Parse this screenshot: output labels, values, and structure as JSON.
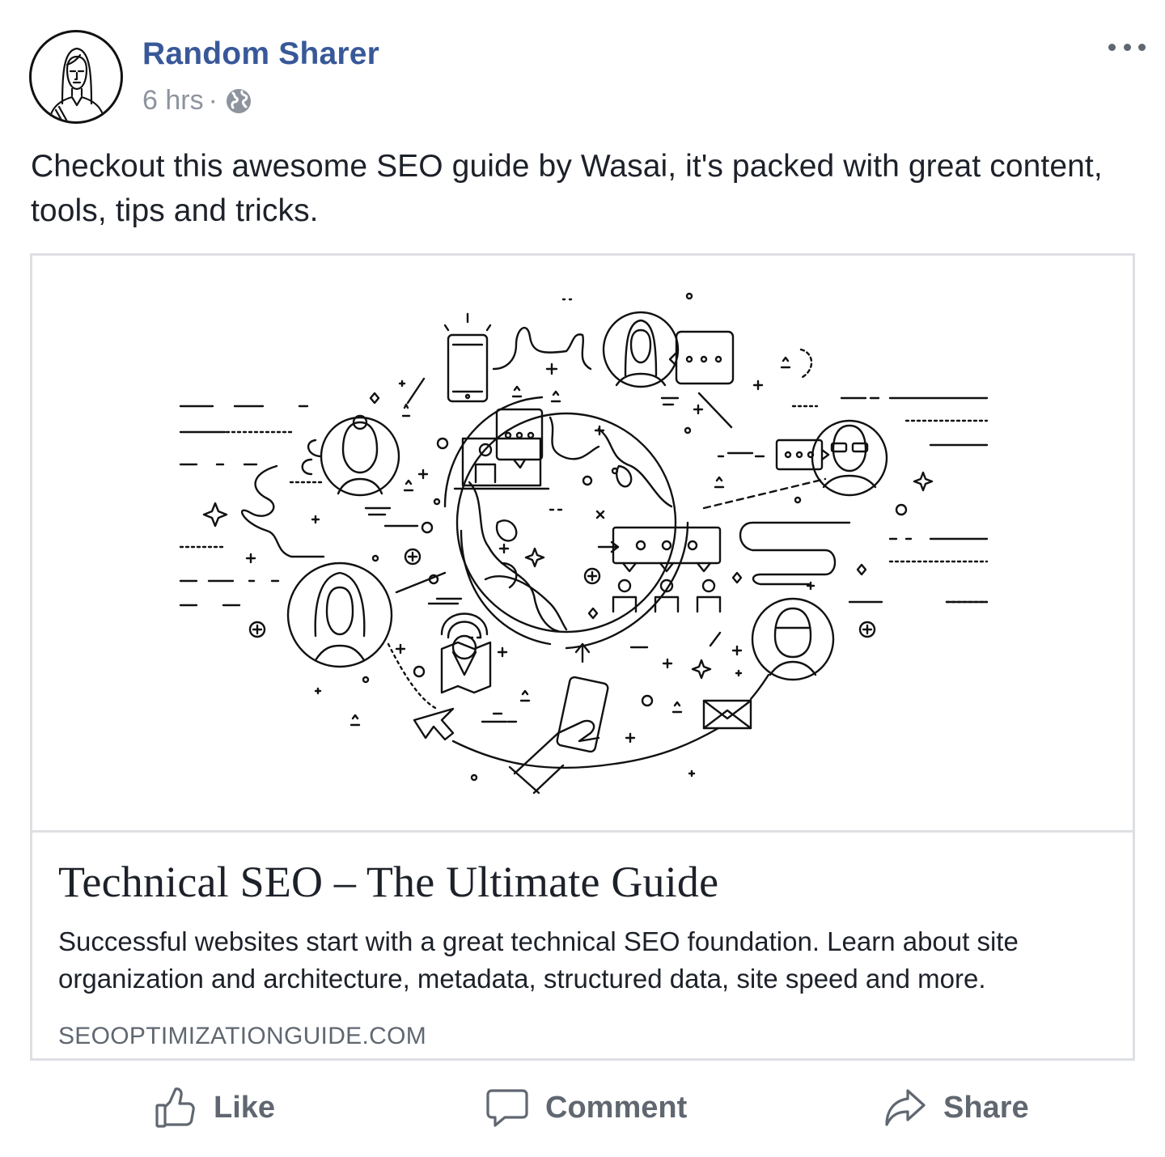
{
  "post": {
    "author": "Random Sharer",
    "time": "6 hrs",
    "separator": "·",
    "privacy_icon": "globe-icon",
    "more_icon": "more-options-icon",
    "message": "Checkout this awesome SEO guide by Wasai, it's packed with great content, tools, tips and tricks."
  },
  "link_card": {
    "image_icon": "seo-network-illustration",
    "title": "Technical SEO – The Ultimate Guide",
    "description": "Successful websites start with a great technical SEO foundation. Learn about site organization and architecture, metadata, structured data, site speed and more.",
    "domain": "SEOOPTIMIZATIONGUIDE.COM"
  },
  "actions": [
    {
      "label": "Like",
      "icon": "thumbs-up-icon"
    },
    {
      "label": "Comment",
      "icon": "comment-icon"
    },
    {
      "label": "Share",
      "icon": "share-icon"
    }
  ],
  "colors": {
    "author_link": "#385898",
    "meta_text": "#8d949e",
    "action_text": "#606770",
    "card_border": "#dddfe2",
    "text": "#1d2129"
  }
}
